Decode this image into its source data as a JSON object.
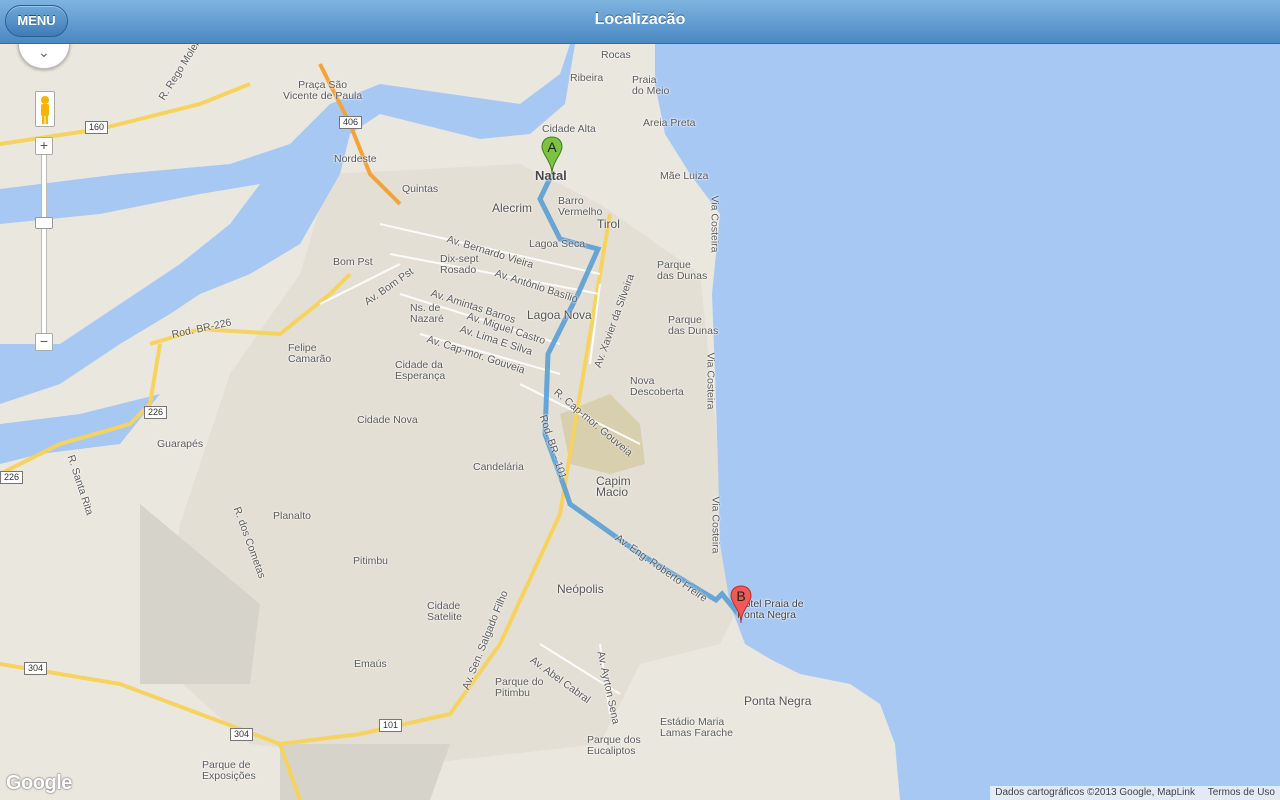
{
  "header": {
    "menu_label": "MENU",
    "title": "Localizacão"
  },
  "map_controls": {
    "pan_icon": "pan-chevron-icon",
    "pegman_icon": "street-view-pegman-icon",
    "zoom_in_label": "+",
    "zoom_out_label": "−"
  },
  "markers": {
    "start": "A",
    "end": "B"
  },
  "places": {
    "rocas": "Rocas",
    "ribeira": "Ribeira",
    "praia_do_meio": "Praia\ndo Meio",
    "cidade_alta": "Cidade Alta",
    "areia_preta": "Areia Preta",
    "natal": "Natal",
    "mae_luiza": "Mãe Luiza",
    "alecrim": "Alecrim",
    "barro_vermelho": "Barro\nVermelho",
    "tirol": "Tirol",
    "lagoa_seca": "Lagoa Seca",
    "parque_das_dunas_1": "Parque\ndas Dunas",
    "parque_das_dunas_2": "Parque\ndas Dunas",
    "bom_pst": "Bom Pst",
    "dix_sept_rosado": "Dix-sept\nRosado",
    "ns_de_nazare": "Ns. de\nNazaré",
    "lagoa_nova": "Lagoa Nova",
    "felipe_camarao": "Felipe\nCamarão",
    "cidade_da_esperanca": "Cidade da\nEsperança",
    "nova_descoberta": "Nova\nDescoberta",
    "cidade_nova": "Cidade Nova",
    "guarapes": "Guarapés",
    "candelaria": "Candelária",
    "capim_macio": "Capim\nMacio",
    "planalto": "Planalto",
    "pitimbu": "Pitimbu",
    "neopolis": "Neópolis",
    "cidade_satelite": "Cidade\nSatelite",
    "hotel": "Hotel Praia de\nPonta Negra",
    "emaus": "Emaús",
    "parque_do_pitimbu": "Parque do\nPitimbu",
    "ponta_negra": "Ponta Negra",
    "estadio": "Estádio Maria\nLamas Farache",
    "parque_dos_eucaliptos": "Parque dos\nEucaliptos",
    "parque_de_exposicoes": "Parque de\nExposições",
    "praca_sao_vicente": "Praça São\nVicente de Paula",
    "nordeste": "Nordeste",
    "quintas": "Quintas"
  },
  "roads": {
    "rego_moleiro": "R. Rego Moleiro",
    "bernardo_vieira": "Av. Bernardo Vieira",
    "antonio_basilio": "Av. Antônio Basílio",
    "bom_pst": "Av. Bom Pst",
    "amintas_barros": "Av. Amintas Barros",
    "miguel_castro": "Av. Miguel Castro",
    "lima_e_silva": "Av. Lima E Silva",
    "cap_mor_gouveia": "Av. Cap-mor. Gouveia",
    "r_cap_mor_gouveia": "R. Cap-mor. Gouveia",
    "xavier_da_silveira": "Av. Xavier da Silveira",
    "br101": "Rod. BR - 101",
    "br226": "Rod. BR-226",
    "roberto_freire": "Av. Eng. Roberto Freire",
    "salgado_filho": "Av. Sen. Salgado Filho",
    "abel_cabral": "Av. Abel Cabral",
    "ayrton_senna": "Av. Ayrton Sena",
    "santa_rita": "R. Santa Rita",
    "dos_cometas": "R. dos Cometas",
    "via_costeira_1": "Via Costeira",
    "via_costeira_2": "Via Costeira",
    "via_costeira_3": "Via Costeira"
  },
  "shields": {
    "s406": "406",
    "s160": "160",
    "s226a": "226",
    "s226b": "226",
    "s304a": "304",
    "s304b": "304",
    "s101": "101"
  },
  "footer": {
    "attribution": "Dados cartográficos ©2013 Google, MapLink",
    "terms": "Termos de Uso"
  },
  "logo": "Google",
  "colors": {
    "header": "#4a89c2",
    "route": "#5a9fd4",
    "water": "#a8c8f4",
    "land": "#eae7df",
    "major_road": "#f6d35f"
  }
}
